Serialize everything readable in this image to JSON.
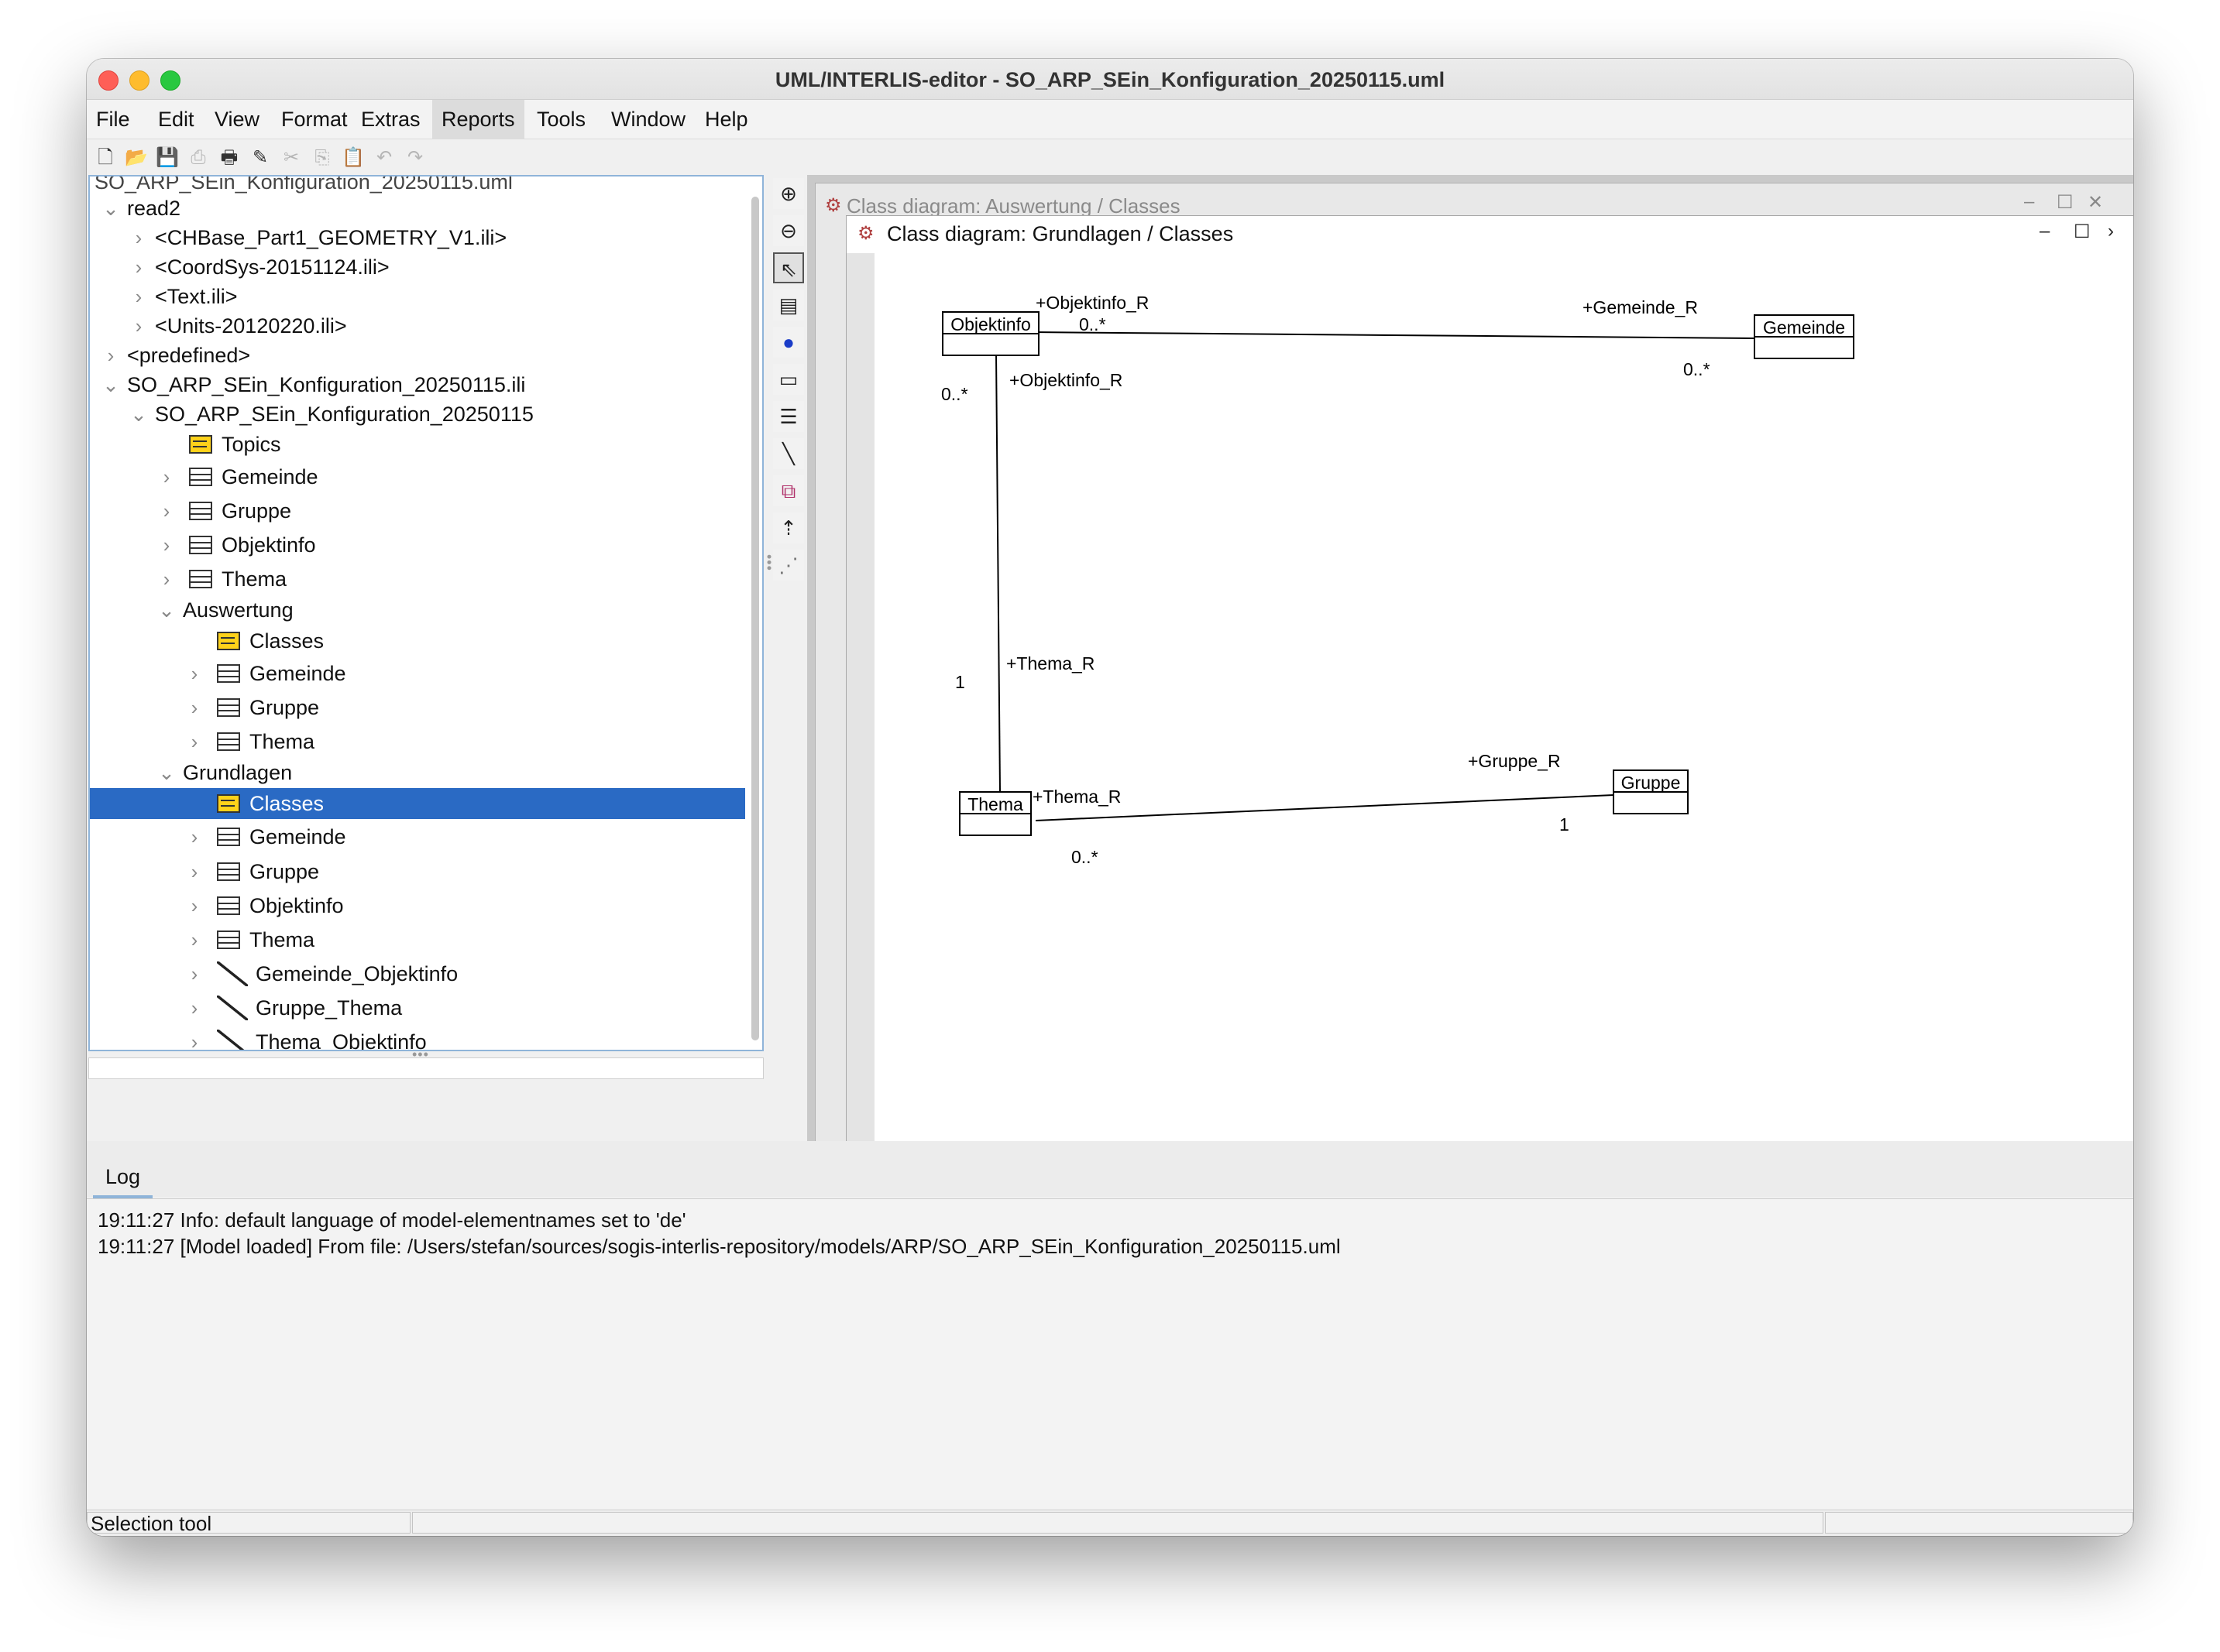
{
  "window": {
    "title": "UML/INTERLIS-editor - SO_ARP_SEin_Konfiguration_20250115.uml"
  },
  "menu": [
    "File",
    "Edit",
    "View",
    "Format",
    "Extras",
    "Reports",
    "Tools",
    "Window",
    "Help"
  ],
  "menu_active": "Reports",
  "toolbar": {
    "icons": [
      "new-file-icon",
      "open-icon",
      "save-icon",
      "save-all-icon",
      "print-icon",
      "check-icon",
      "cut-icon",
      "copy-icon",
      "paste-icon",
      "undo-icon",
      "redo-icon"
    ]
  },
  "tree": {
    "clipped_top": "SO_ARP_SEin_Konfiguration_20250115.uml",
    "items": [
      {
        "label": "read2",
        "level": 0,
        "twisty": "open",
        "icon": "none"
      },
      {
        "label": "<CHBase_Part1_GEOMETRY_V1.ili>",
        "level": 1,
        "twisty": "closed",
        "icon": "none"
      },
      {
        "label": "<CoordSys-20151124.ili>",
        "level": 1,
        "twisty": "closed",
        "icon": "none"
      },
      {
        "label": "<Text.ili>",
        "level": 1,
        "twisty": "closed",
        "icon": "none"
      },
      {
        "label": "<Units-20120220.ili>",
        "level": 1,
        "twisty": "closed",
        "icon": "none"
      },
      {
        "label": "<predefined>",
        "level": 0,
        "twisty": "closed",
        "icon": "none"
      },
      {
        "label": "SO_ARP_SEin_Konfiguration_20250115.ili",
        "level": 0,
        "twisty": "open",
        "icon": "none"
      },
      {
        "label": "SO_ARP_SEin_Konfiguration_20250115",
        "level": 1,
        "twisty": "open",
        "icon": "none"
      },
      {
        "label": "Topics",
        "level": 2,
        "twisty": "none",
        "icon": "package"
      },
      {
        "label": "Gemeinde",
        "level": 2,
        "twisty": "closed",
        "icon": "class"
      },
      {
        "label": "Gruppe",
        "level": 2,
        "twisty": "closed",
        "icon": "class"
      },
      {
        "label": "Objektinfo",
        "level": 2,
        "twisty": "closed",
        "icon": "class"
      },
      {
        "label": "Thema",
        "level": 2,
        "twisty": "closed",
        "icon": "class"
      },
      {
        "label": "Auswertung",
        "level": 2,
        "twisty": "open",
        "icon": "none"
      },
      {
        "label": "Classes",
        "level": 3,
        "twisty": "none",
        "icon": "package"
      },
      {
        "label": "Gemeinde",
        "level": 3,
        "twisty": "closed",
        "icon": "class"
      },
      {
        "label": "Gruppe",
        "level": 3,
        "twisty": "closed",
        "icon": "class"
      },
      {
        "label": "Thema",
        "level": 3,
        "twisty": "closed",
        "icon": "class"
      },
      {
        "label": "Grundlagen",
        "level": 2,
        "twisty": "open",
        "icon": "none"
      },
      {
        "label": "Classes",
        "level": 3,
        "twisty": "none",
        "icon": "package",
        "selected": true
      },
      {
        "label": "Gemeinde",
        "level": 3,
        "twisty": "closed",
        "icon": "class"
      },
      {
        "label": "Gruppe",
        "level": 3,
        "twisty": "closed",
        "icon": "class"
      },
      {
        "label": "Objektinfo",
        "level": 3,
        "twisty": "closed",
        "icon": "class"
      },
      {
        "label": "Thema",
        "level": 3,
        "twisty": "closed",
        "icon": "class"
      },
      {
        "label": "Gemeinde_Objektinfo",
        "level": 3,
        "twisty": "closed",
        "icon": "association"
      },
      {
        "label": "Gruppe_Thema",
        "level": 3,
        "twisty": "closed",
        "icon": "association"
      },
      {
        "label": "Thema_Objektinfo",
        "level": 3,
        "twisty": "closed",
        "icon": "association"
      }
    ]
  },
  "palette": {
    "tools": [
      "zoom-in-icon",
      "zoom-out-icon",
      "selection-arrow-icon",
      "note-icon",
      "package-icon",
      "class-tool-icon",
      "enumeration-icon",
      "association-line-icon",
      "composite-icon",
      "inheritance-icon",
      "dependency-icon"
    ],
    "pressed": "selection-arrow-icon"
  },
  "diagram": {
    "back_title": "Class diagram: Auswertung / Classes",
    "front_title": "Class diagram: Grundlagen / Classes",
    "classes": {
      "objektinfo": "Objektinfo",
      "gemeinde": "Gemeinde",
      "thema": "Thema",
      "gruppe": "Gruppe"
    },
    "labels": {
      "objektinfo_r_top": "+Objektinfo_R",
      "mult_obj_gem": "0..*",
      "gemeinde_r": "+Gemeinde_R",
      "mult_gem": "0..*",
      "mult_obj_thema": "0..*",
      "objektinfo_r_side": "+Objektinfo_R",
      "thema_r_vertical": "+Thema_R",
      "mult_thema_one": "1",
      "thema_r_horizontal": "+Thema_R",
      "gruppe_r": "+Gruppe_R",
      "mult_gruppe_one": "1",
      "mult_thema_gruppe": "0..*"
    }
  },
  "log": {
    "tab": "Log",
    "lines": [
      "19:11:27 Info: default language of model-elementnames set to 'de'",
      "19:11:27 [Model loaded] From file: /Users/stefan/sources/sogis-interlis-repository/models/ARP/SO_ARP_SEin_Konfiguration_20250115.uml"
    ]
  },
  "status": {
    "text": "Selection tool"
  }
}
